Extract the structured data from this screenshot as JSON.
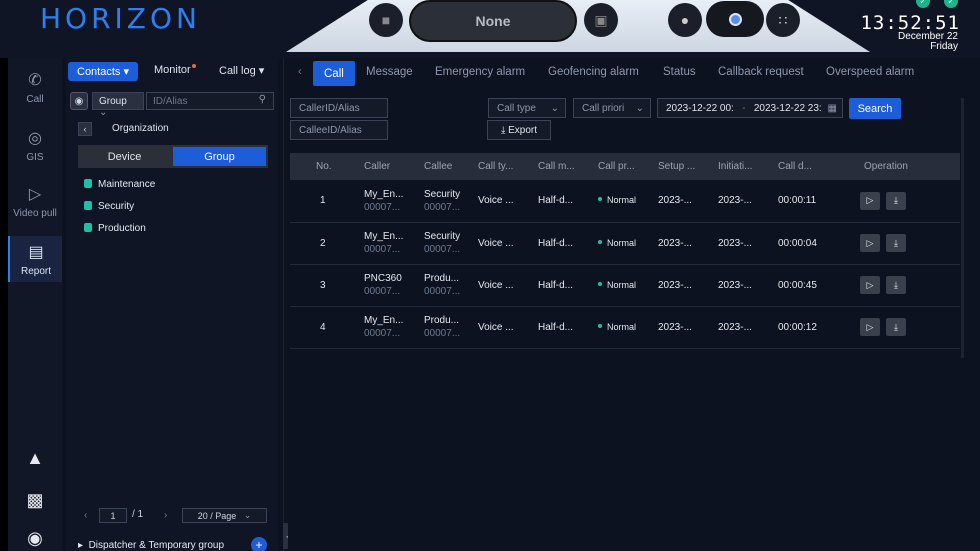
{
  "app": {
    "brand": "HORIZON"
  },
  "console": {
    "status": "None"
  },
  "clock": {
    "time": "13:52:51",
    "date": "December 22",
    "weekday": "Friday"
  },
  "nav": [
    {
      "label": "Call",
      "icon": "phone-icon"
    },
    {
      "label": "GIS",
      "icon": "map-pin-icon"
    },
    {
      "label": "Video pull",
      "icon": "video-icon"
    },
    {
      "label": "Report",
      "icon": "report-icon",
      "active": true
    }
  ],
  "panel": {
    "tabs": {
      "contacts": "Contacts ▾",
      "monitor": "Monitor",
      "calllog": "Call log ▾"
    },
    "search_type": "Group",
    "search_placeholder": "ID/Alias",
    "breadcrumb": "Organization",
    "segment": {
      "device": "Device",
      "group": "Group"
    },
    "groups": [
      "Maintenance",
      "Security",
      "Production"
    ],
    "pager": {
      "page": "1",
      "total": "/ 1",
      "size": "20 / Page"
    },
    "dispatcher": "Dispatcher & Temporary group"
  },
  "main": {
    "tabs": [
      "Call",
      "Message",
      "Emergency alarm",
      "Geofencing alarm",
      "Status",
      "Callback request",
      "Overspeed alarm"
    ],
    "filters": {
      "caller_placeholder": "CallerID/Alias",
      "callee_placeholder": "CalleeID/Alias",
      "call_type": "Call type",
      "call_priority": "Call priori",
      "date_from": "2023-12-22 00:",
      "date_to": "2023-12-22 23:",
      "search": "Search",
      "export": "⤓ Export"
    },
    "columns": [
      "No.",
      "Caller",
      "Callee",
      "Call ty...",
      "Call m...",
      "Call pr...",
      "Setup ...",
      "Initiati...",
      "Call d...",
      "Operation"
    ],
    "rows": [
      {
        "no": "1",
        "caller": "My_En...",
        "caller_id": "00007...",
        "callee": "Security",
        "callee_id": "00007...",
        "type": "Voice ...",
        "mode": "Half-d...",
        "priority": "Normal",
        "setup": "2023-...",
        "init": "2023-...",
        "duration": "00:00:11"
      },
      {
        "no": "2",
        "caller": "My_En...",
        "caller_id": "00007...",
        "callee": "Security",
        "callee_id": "00007...",
        "type": "Voice ...",
        "mode": "Half-d...",
        "priority": "Normal",
        "setup": "2023-...",
        "init": "2023-...",
        "duration": "00:00:04"
      },
      {
        "no": "3",
        "caller": "PNC360",
        "caller_id": "00007...",
        "callee": "Produ...",
        "callee_id": "00007...",
        "type": "Voice ...",
        "mode": "Half-d...",
        "priority": "Normal",
        "setup": "2023-...",
        "init": "2023-...",
        "duration": "00:00:45"
      },
      {
        "no": "4",
        "caller": "My_En...",
        "caller_id": "00007...",
        "callee": "Produ...",
        "callee_id": "00007...",
        "type": "Voice ...",
        "mode": "Half-d...",
        "priority": "Normal",
        "setup": "2023-...",
        "init": "2023-...",
        "duration": "00:00:12"
      }
    ]
  }
}
